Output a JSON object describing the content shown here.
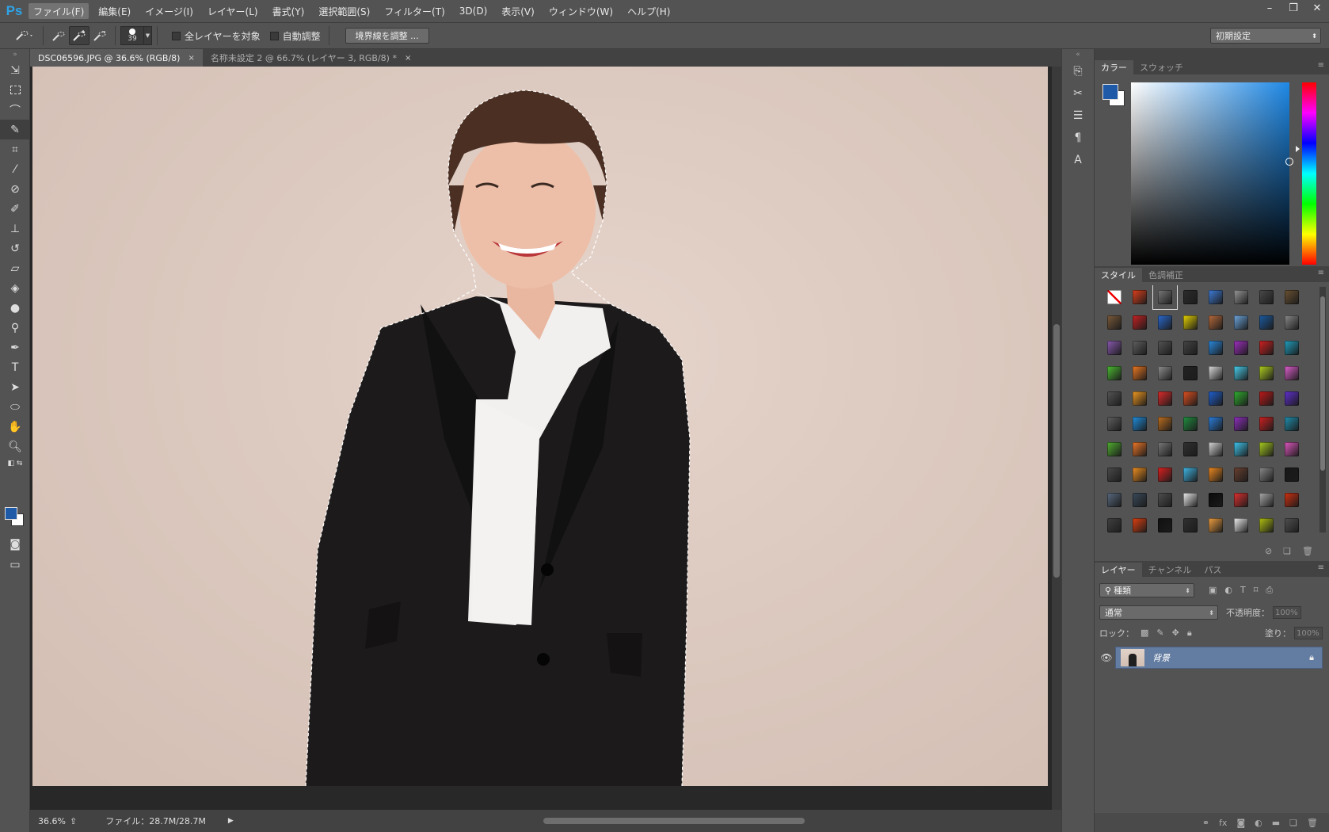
{
  "app": {
    "logo": "Ps"
  },
  "menu": [
    {
      "label": "ファイル(F)",
      "active": true
    },
    {
      "label": "編集(E)"
    },
    {
      "label": "イメージ(I)"
    },
    {
      "label": "レイヤー(L)"
    },
    {
      "label": "書式(Y)"
    },
    {
      "label": "選択範囲(S)"
    },
    {
      "label": "フィルター(T)"
    },
    {
      "label": "3D(D)"
    },
    {
      "label": "表示(V)"
    },
    {
      "label": "ウィンドウ(W)"
    },
    {
      "label": "ヘルプ(H)"
    }
  ],
  "window_controls": {
    "minimize": "–",
    "restore": "❐",
    "close": "✕"
  },
  "options": {
    "brush_size": "39",
    "sample_all_layers": "全レイヤーを対象",
    "auto_enhance": "自動調整",
    "refine_edge": "境界線を調整 ...",
    "workspace": "初期設定"
  },
  "tabs": [
    {
      "label": "DSC06596.JPG @ 36.6% (RGB/8)",
      "close": "×"
    },
    {
      "label": "名称未設定 2 @ 66.7% (レイヤー 3, RGB/8) *",
      "close": "×"
    }
  ],
  "status": {
    "zoom": "36.6%",
    "file_info": "ファイル：28.7M/28.7M"
  },
  "colors": {
    "foreground": "#1f5aa8",
    "background": "#ffffff",
    "selected_layer": "#637ca1"
  },
  "color_panel": {
    "tabs": [
      "カラー",
      "スウォッチ"
    ]
  },
  "styles_panel": {
    "tabs": [
      "スタイル",
      "色調補正"
    ],
    "swatches": [
      "#ffffff",
      "#e0401c",
      "#7a7a7a",
      "#2c2c2c",
      "#3f7dd9",
      "#9a9a9a",
      "#4a4a4a",
      "#6b5233",
      "#7b5a3a",
      "#c82222",
      "#2a6ad0",
      "#e8d500",
      "#b86a3c",
      "#6fa8e0",
      "#1a5aa0",
      "#8a8a8a",
      "#8a5ab0",
      "#606060",
      "#555555",
      "#444444",
      "#2a8ae0",
      "#a030c0",
      "#d02020",
      "#20a0c0",
      "#4cbc32",
      "#f07a22",
      "#909090",
      "#222222",
      "#dddddd",
      "#4ad2f0",
      "#b0d020",
      "#e060d0",
      "#555555",
      "#f29a20",
      "#e02a2a",
      "#e05020",
      "#2060d0",
      "#30b030",
      "#c01818",
      "#6030d0",
      "#606060",
      "#2090e0",
      "#c07020",
      "#209040",
      "#2a80e0",
      "#9030c0",
      "#d02020",
      "#2090b0",
      "#50b030",
      "#f07828",
      "#7a7a7a",
      "#303030",
      "#d8d8d8",
      "#40c8f0",
      "#a8cc20",
      "#e058c0",
      "#4a4a4a",
      "#f29020",
      "#e02020",
      "#40b8e8",
      "#f08a20",
      "#6a4030",
      "#8a8a8a",
      "#181818",
      "#5a6a80",
      "#3a4a5a",
      "#505050",
      "#eeeeee",
      "#0a0a0a",
      "#e03030",
      "#aaaaaa",
      "#d03010",
      "#404040",
      "#e04010",
      "#101010",
      "#303030",
      "#f0a040",
      "#f0f0f0",
      "#b0c010",
      "#505050",
      "#f0a040",
      "#303030",
      "#505050",
      "#a0a0a0",
      "#808080",
      "#d0d0d0",
      "#909090",
      "#70a0e0"
    ]
  },
  "layers_panel": {
    "tabs": [
      "レイヤー",
      "チャンネル",
      "パス"
    ],
    "filter_kind": "種類",
    "blend_mode": "通常",
    "opacity_label": "不透明度：",
    "opacity_value": "100%",
    "lock_label": "ロック：",
    "fill_label": "塗り：",
    "fill_value": "100%",
    "layers": [
      {
        "name": "背景",
        "visible": true,
        "locked": true
      }
    ]
  }
}
